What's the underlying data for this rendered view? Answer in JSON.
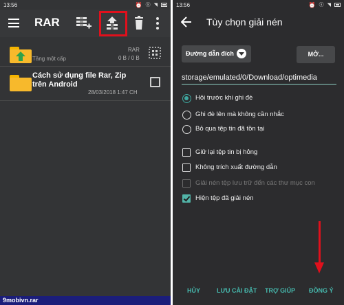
{
  "left": {
    "status": {
      "time": "13:56"
    },
    "toolbar": {
      "title": "RAR",
      "icons": [
        "menu-icon",
        "add-archive-icon",
        "extract-icon",
        "delete-icon",
        "more-icon"
      ],
      "highlight_color": "#e0101c"
    },
    "files": [
      {
        "name": "Tầng một cấp",
        "type": "RAR",
        "size": "0 B / 0 B"
      },
      {
        "name": "Cách sử dụng file Rar, Zip trên Android",
        "date": "28/03/2018 1:47 CH"
      }
    ],
    "watermark": "9mobivn.rar"
  },
  "right": {
    "status": {
      "time": "13:56"
    },
    "title": "Tùy chọn giải nén",
    "dest_button": "Đường dẫn đích",
    "open_button": "MỞ...",
    "path": "storage/emulated/0/Download/optimedia",
    "radio_options": [
      {
        "label": "Hỏi trước khi ghi đè",
        "selected": true
      },
      {
        "label": "Ghi đè lên mà không cần nhắc",
        "selected": false
      },
      {
        "label": "Bỏ qua tệp tin đã tồn tại",
        "selected": false
      }
    ],
    "check_options": [
      {
        "label": "Giữ lại tệp tin bị hỏng",
        "checked": false,
        "disabled": false
      },
      {
        "label": "Không trích xuất đường dẫn",
        "checked": false,
        "disabled": false
      },
      {
        "label": "Giải nén tệp lưu trữ đến các thư mục con",
        "checked": false,
        "disabled": true
      },
      {
        "label": "Hiện tệp đã giải nén",
        "checked": true,
        "disabled": false
      }
    ],
    "footer": {
      "cancel": "HỦY",
      "save_settings": "LƯU CÀI ĐẶT",
      "help": "TRỢ GIÚP",
      "ok": "ĐỒNG Ý"
    },
    "accent_color": "#46b8ad"
  }
}
